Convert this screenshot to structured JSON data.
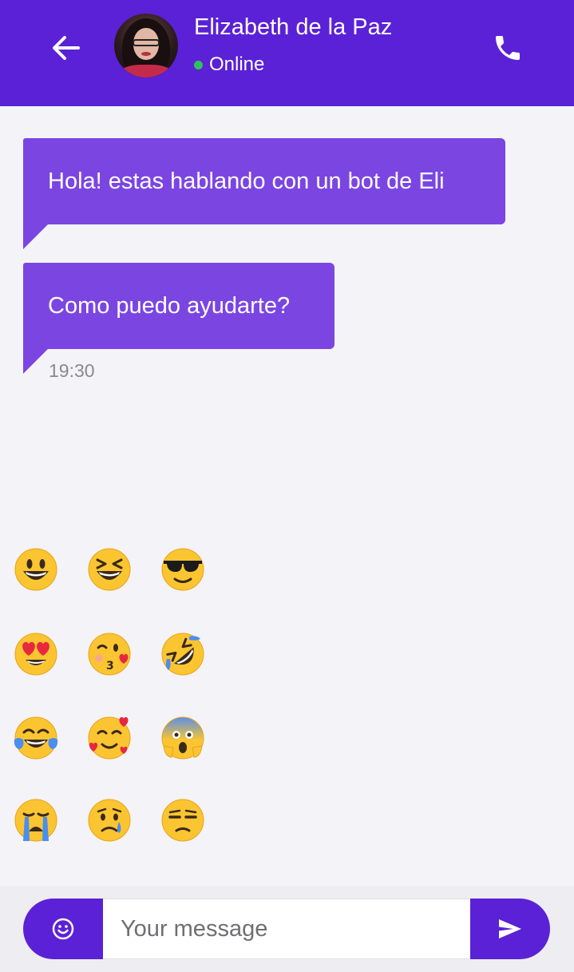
{
  "header": {
    "contact_name": "Elizabeth de la Paz",
    "status": "Online",
    "status_color": "#2ec25a",
    "bar_color": "#5b21d6"
  },
  "messages": [
    {
      "text": "Hola! estas hablando con un bot de Eli"
    },
    {
      "text": "Como puedo ayudarte?",
      "time": "19:30"
    }
  ],
  "bubble_color": "#7b45e2",
  "emoji_picker": [
    [
      "grinning-face",
      "laughing-squinting-face",
      "sunglasses-face"
    ],
    [
      "heart-eyes-face",
      "kissing-heart-face",
      "rolling-on-floor-laughing-face"
    ],
    [
      "tears-of-joy-face",
      "smiling-face-with-hearts",
      "screaming-in-fear-face"
    ],
    [
      "loudly-crying-face",
      "crying-face",
      "unamused-face"
    ]
  ],
  "composer": {
    "placeholder": "Your message"
  }
}
